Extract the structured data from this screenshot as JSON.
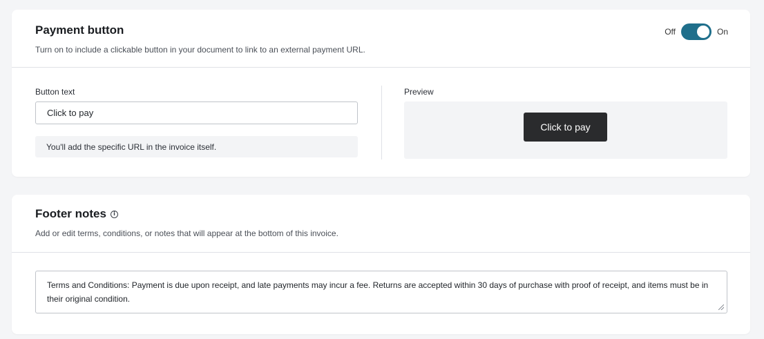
{
  "payment_button": {
    "title": "Payment button",
    "description": "Turn on to include a clickable button in your document to link to an external payment URL.",
    "toggle": {
      "off_label": "Off",
      "on_label": "On",
      "state": "on",
      "color": "#1f6f8b"
    },
    "button_text_label": "Button text",
    "button_text_value": "Click to pay",
    "hint": "You'll add the specific URL in the invoice itself.",
    "preview_label": "Preview",
    "preview_button_label": "Click to pay"
  },
  "footer_notes": {
    "title": "Footer notes",
    "info_icon": "info-icon",
    "description": "Add or edit terms, conditions, or notes that will appear at the bottom of this invoice.",
    "notes_value": "Terms and Conditions: Payment is due upon receipt, and late payments may incur a fee. Returns are accepted within 30 days of purchase with proof of receipt, and items must be in their original condition."
  }
}
